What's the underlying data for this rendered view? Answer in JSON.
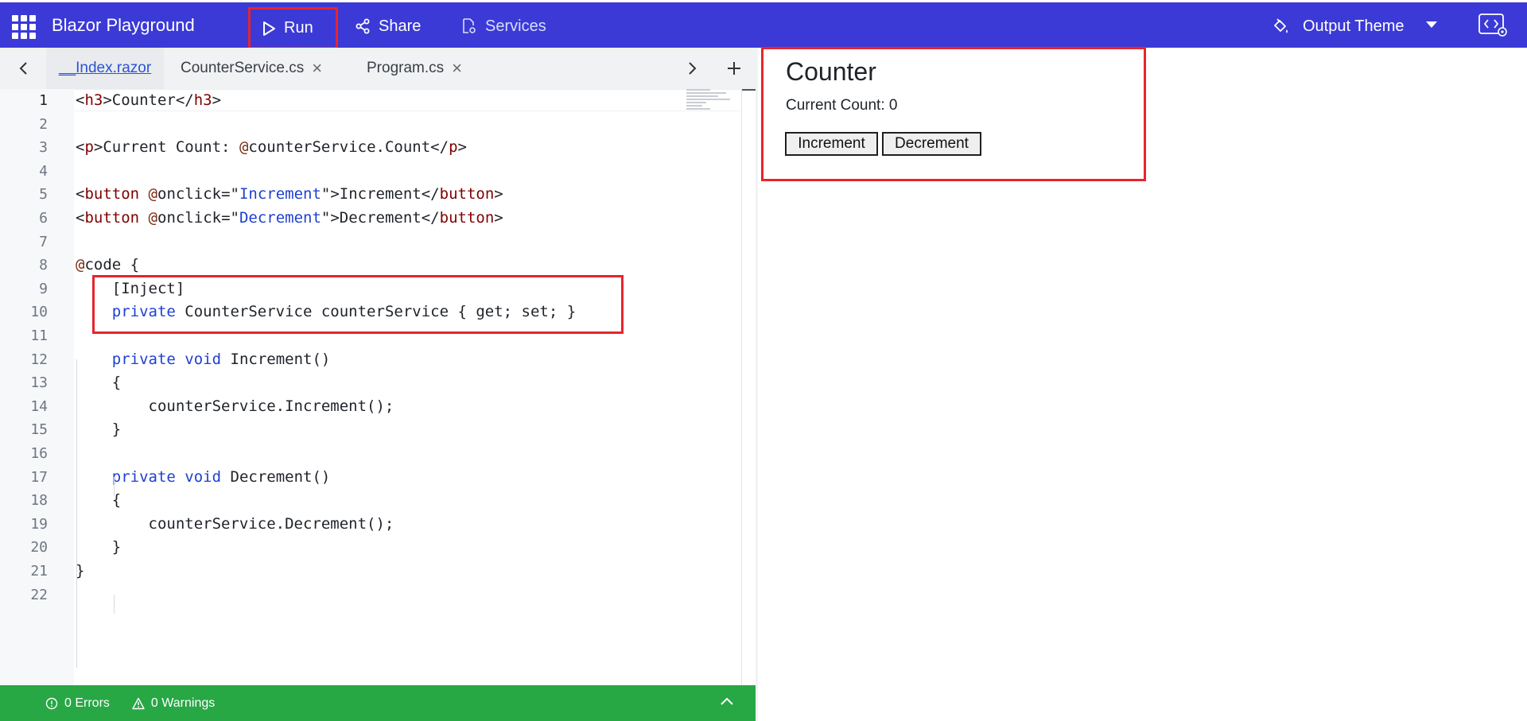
{
  "header": {
    "app_title": "Blazor Playground",
    "run_label": "Run",
    "share_label": "Share",
    "services_label": "Services",
    "theme_label": "Output Theme",
    "bg_color": "#3b3ad6"
  },
  "tabs": [
    {
      "label": "__Index.razor",
      "active": true
    },
    {
      "label": "CounterService.cs",
      "closable": true
    },
    {
      "label": "Program.cs",
      "closable": true
    }
  ],
  "editor": {
    "line_numbers": [
      "1",
      "2",
      "3",
      "4",
      "5",
      "6",
      "7",
      "8",
      "9",
      "10",
      "11",
      "12",
      "13",
      "14",
      "15",
      "16",
      "17",
      "18",
      "19",
      "20",
      "21",
      "22"
    ],
    "lines": [
      "<h3>Counter</h3>",
      "",
      "<p>Current Count: @counterService.Count</p>",
      "",
      "<button @onclick=\"Increment\">Increment</button>",
      "<button @onclick=\"Decrement\">Decrement</button>",
      "",
      "@code {",
      "    [Inject]",
      "    private CounterService counterService { get; set; }",
      "",
      "    private void Increment()",
      "    {",
      "        counterService.Increment();",
      "    }",
      "",
      "    private void Decrement()",
      "    {",
      "        counterService.Decrement();",
      "    }",
      "}",
      ""
    ]
  },
  "status": {
    "errors": "0 Errors",
    "warnings": "0 Warnings",
    "bg_color": "#28a745"
  },
  "output": {
    "title": "Counter",
    "count_text": "Current Count: 0",
    "increment_label": "Increment",
    "decrement_label": "Decrement"
  },
  "icons": {
    "run": "play-icon",
    "share": "share-icon",
    "services": "services-icon",
    "theme": "paint-bucket-icon",
    "settings": "code-settings-icon"
  }
}
